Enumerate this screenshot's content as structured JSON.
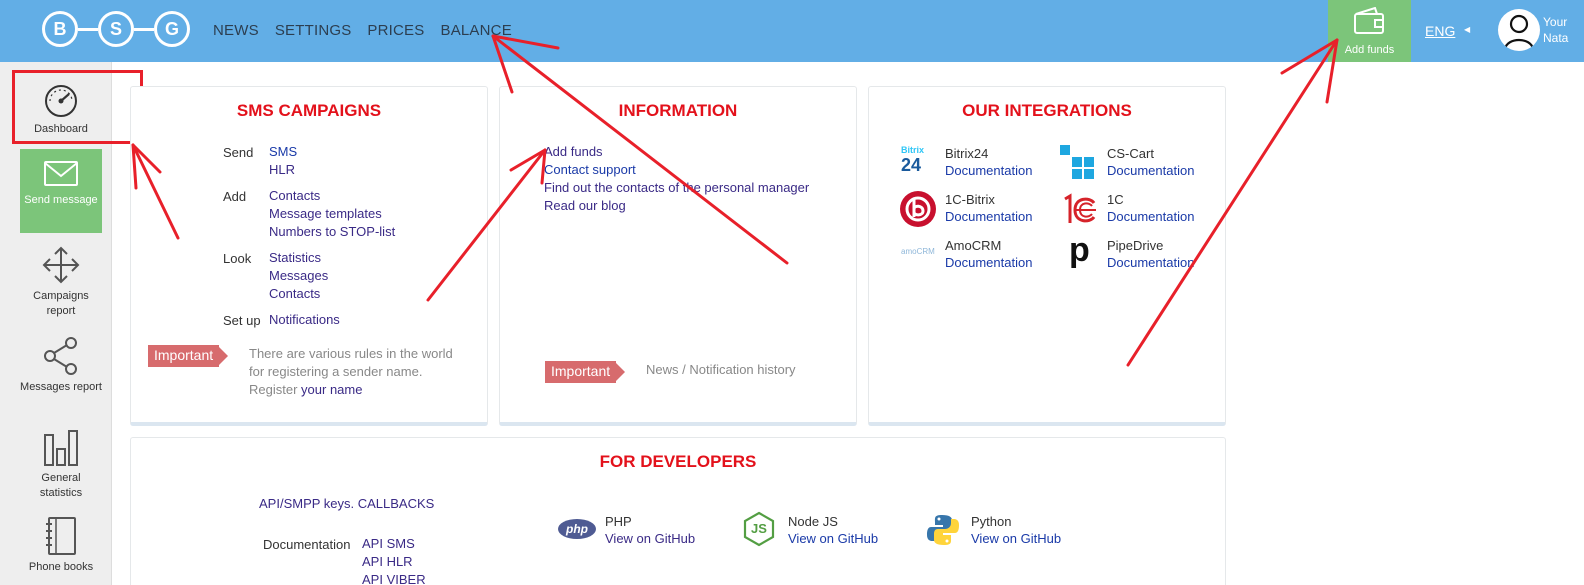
{
  "brand": {
    "letters": [
      "B",
      "S",
      "G"
    ]
  },
  "topnav": [
    "NEWS",
    "SETTINGS",
    "PRICES",
    "BALANCE"
  ],
  "add_funds": {
    "label": "Add funds"
  },
  "lang": {
    "current": "ENG"
  },
  "user": {
    "line1": "Your",
    "line2": "Nata"
  },
  "sidebar": {
    "items": [
      {
        "label": "Dashboard",
        "icon": "speedometer-icon"
      },
      {
        "label": "Send message",
        "icon": "envelope-icon"
      },
      {
        "label": "Campaigns report",
        "icon": "move-arrows-icon"
      },
      {
        "label": "Messages report",
        "icon": "share-icon"
      },
      {
        "label": "General statistics",
        "icon": "bar-chart-icon"
      },
      {
        "label": "Phone books",
        "icon": "notebook-icon"
      }
    ]
  },
  "sms": {
    "title": "SMS CAMPAIGNS",
    "send_label": "Send",
    "send_links": [
      "SMS",
      "HLR"
    ],
    "add_label": "Add",
    "add_links": [
      "Contacts",
      "Message templates",
      "Numbers to STOP-list"
    ],
    "look_label": "Look",
    "look_links": [
      "Statistics",
      "Messages",
      "Contacts"
    ],
    "setup_label": "Set up",
    "setup_links": [
      "Notifications"
    ],
    "important": "Important",
    "note_line1": "There are various rules in the world",
    "note_line2": "for registering a sender name.",
    "note_line3_prefix": "Register",
    "note_line3_link": "your name"
  },
  "info": {
    "title": "INFORMATION",
    "links": [
      "Add funds",
      "Contact support",
      "Find out the contacts of the personal manager",
      "Read our blog"
    ],
    "important": "Important",
    "history": "News / Notification history"
  },
  "integrations": {
    "title": "OUR INTEGRATIONS",
    "doc_label": "Documentation",
    "items": [
      {
        "name": "Bitrix24",
        "icon": "bitrix24-logo",
        "logo_text": "Bitrix",
        "logo_num": "24"
      },
      {
        "name": "CS-Cart",
        "icon": "cs-cart-logo"
      },
      {
        "name": "1C-Bitrix",
        "icon": "1c-bitrix-logo"
      },
      {
        "name": "1C",
        "icon": "1c-logo"
      },
      {
        "name": "AmoCRM",
        "icon": "amocrm-logo",
        "logo_text": "amoCRM"
      },
      {
        "name": "PipeDrive",
        "icon": "pipedrive-logo",
        "logo_text": "p"
      }
    ]
  },
  "developers": {
    "title": "FOR DEVELOPERS",
    "keys_link": "API/SMPP keys. CALLBACKS",
    "doc_label": "Documentation",
    "doc_links": [
      "API SMS",
      "API HLR",
      "API VIBER"
    ],
    "github_label": "View on GitHub",
    "langs": [
      {
        "name": "PHP",
        "icon": "php-logo",
        "logo_text": "php"
      },
      {
        "name": "Node JS",
        "icon": "nodejs-logo",
        "logo_text": "JS"
      },
      {
        "name": "Python",
        "icon": "python-logo"
      }
    ]
  },
  "colors": {
    "topbar": "#62aee6",
    "accent_green": "#7cc57a",
    "title_red": "#e3111b",
    "important_bg": "#d76b6d",
    "annotation_red": "#e8202a"
  }
}
